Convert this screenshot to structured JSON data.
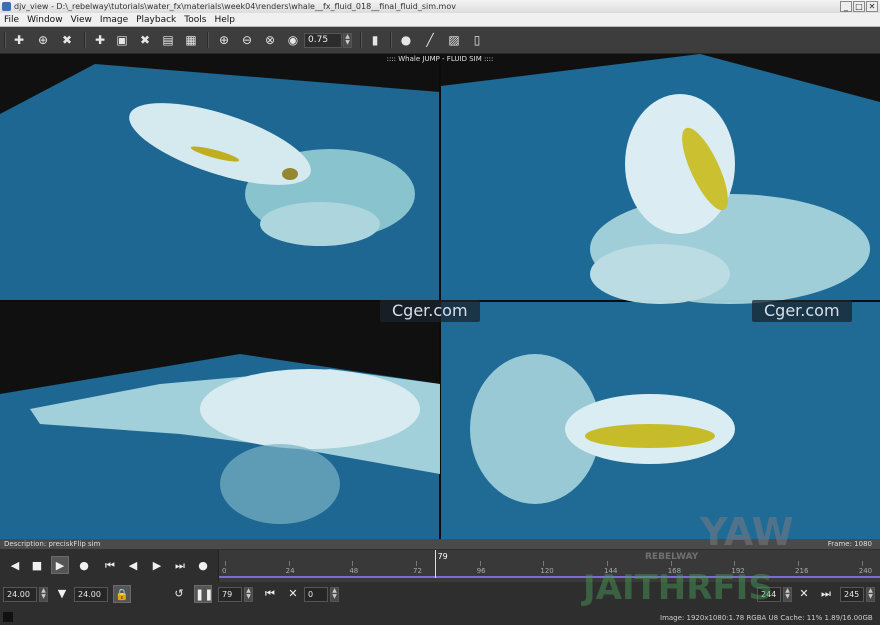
{
  "window": {
    "title": "djv_view - D:\\_rebelway\\tutorials\\water_fx\\materials\\week04\\renders\\whale__fx_fluid_018__final_fluid_sim.mov",
    "buttons": [
      "_",
      "□",
      "✕"
    ]
  },
  "menu": [
    "File",
    "Window",
    "View",
    "Image",
    "Playback",
    "Tools",
    "Help"
  ],
  "toolbar": {
    "zoom_value": "0.75"
  },
  "viewer": {
    "title": ":::: Whale JUMP - FLUID SIM ::::",
    "watermark_left": "Cger.com",
    "watermark_right": "Cger.com",
    "background_color": "#1d6792"
  },
  "infobar": {
    "description": "Description: preciskFlip sim",
    "frame": "Frame: 1080"
  },
  "timeline": {
    "current_frame": "79",
    "ticks": [
      "0",
      "24",
      "48",
      "72",
      "96",
      "120",
      "144",
      "168",
      "192",
      "216",
      "240"
    ],
    "range_start": 0,
    "range_end": 245,
    "accent_color": "#7b6bd6"
  },
  "playback": {
    "speed_field": "24.00",
    "fps_field": "24.00",
    "frame_field": "79",
    "in_field": "0",
    "out_field": "244",
    "end_field": "245"
  },
  "status": {
    "text": "Image: 1920x1080:1.78 RGBA U8  Cache: 11% 1.89/16.00GB"
  },
  "brand": {
    "line1": "REBELWAY",
    "line2": "YAW",
    "line3": "JAITHRFIS"
  }
}
